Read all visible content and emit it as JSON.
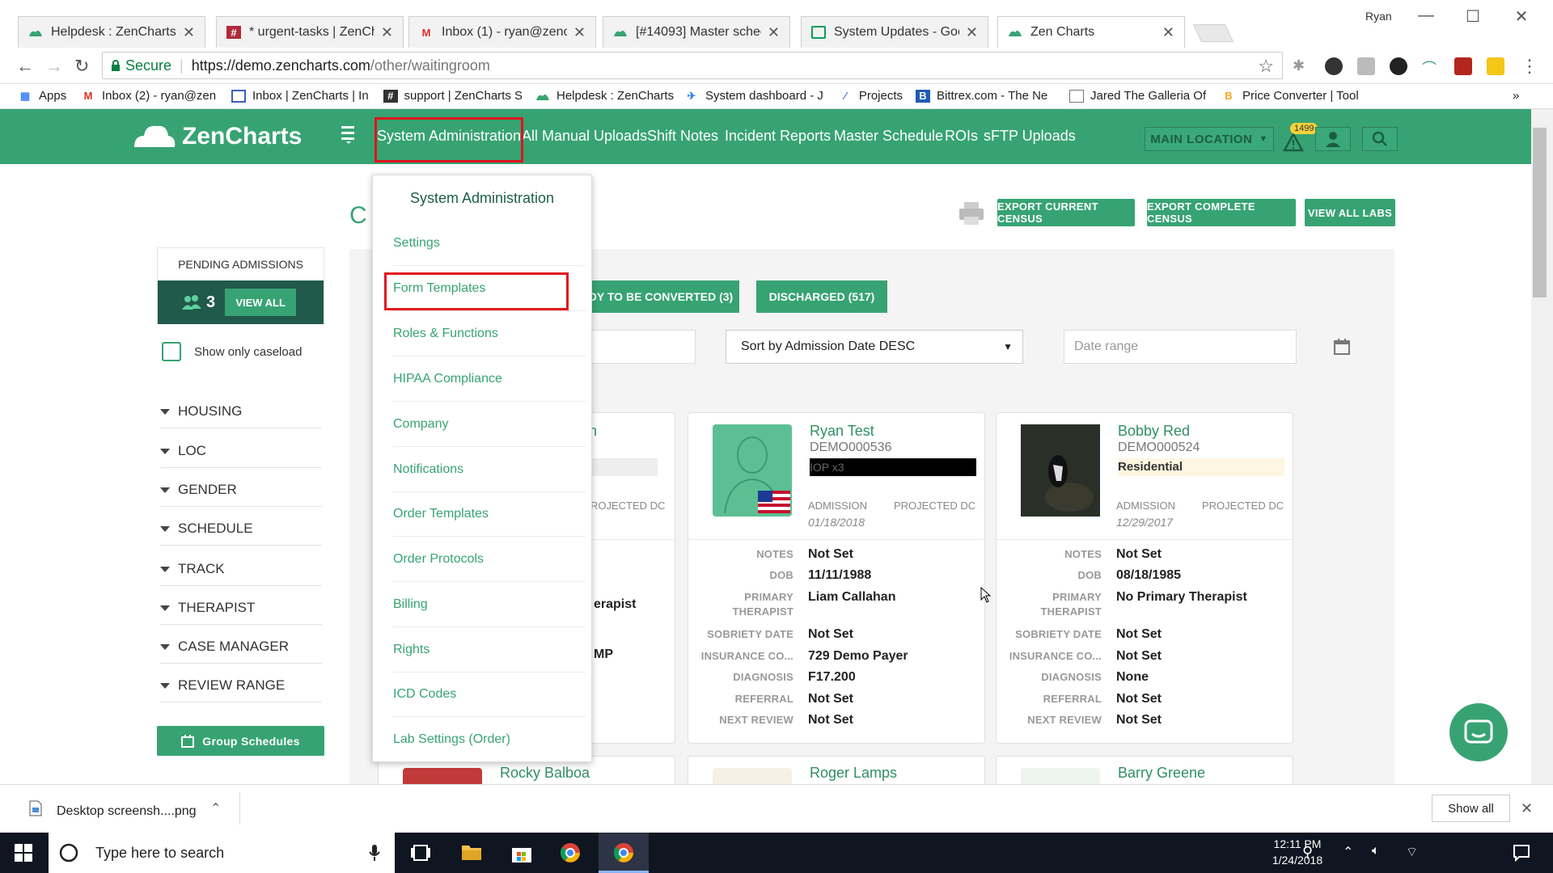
{
  "browser": {
    "tabs": [
      {
        "title": "Helpdesk : ZenCharts",
        "icon": "zencharts-icon"
      },
      {
        "title": "* urgent-tasks | ZenChart",
        "icon": "slack-icon"
      },
      {
        "title": "Inbox (1) - ryan@zenchar",
        "icon": "gmail-icon"
      },
      {
        "title": "[#14093] Master schedul",
        "icon": "zencharts-icon"
      },
      {
        "title": "System Updates - Googl",
        "icon": "sheets-icon"
      },
      {
        "title": "Zen Charts",
        "icon": "zencharts-icon"
      }
    ],
    "window_user": "Ryan",
    "secure_label": "Secure",
    "url_host": "https://demo.zencharts.com",
    "url_path": "/other/waitingroom",
    "bookmarks": [
      "Apps",
      "Inbox (2) - ryan@zen",
      "Inbox | ZenCharts | In",
      "support | ZenCharts S",
      "Helpdesk : ZenCharts",
      "System dashboard - J",
      "Projects",
      "Bittrex.com - The Ne",
      "Jared The Galleria Of",
      "Price Converter | Tool"
    ],
    "bookmarks_overflow": "»"
  },
  "app": {
    "logo": "ZenCharts",
    "nav": [
      "System Administration",
      "All Manual Uploads",
      "Shift Notes",
      "Incident Reports",
      "Master Schedule",
      "ROIs",
      "sFTP Uploads"
    ],
    "location_btn": "MAIN LOCATION",
    "alert_count": "1499",
    "page_title_partial": "C",
    "header_buttons": [
      "EXPORT CURRENT CENSUS",
      "EXPORT COMPLETE CENSUS",
      "VIEW ALL LABS"
    ],
    "pending": {
      "title": "PENDING ADMISSIONS",
      "count": "3",
      "view_all": "VIEW ALL"
    },
    "caseload_label": "Show only caseload",
    "filters": [
      "HOUSING",
      "LOC",
      "GENDER",
      "SCHEDULE",
      "TRACK",
      "THERAPIST",
      "CASE MANAGER",
      "REVIEW RANGE"
    ],
    "group_schedules": "Group Schedules",
    "status_tabs": [
      "DY TO BE CONVERTED (3)",
      "DISCHARGED (517)"
    ],
    "sort_label": "Sort by Admission Date DESC",
    "date_range_placeholder": "Date range",
    "field_labels": {
      "notes": "NOTES",
      "dob": "DOB",
      "therapist": "PRIMARY THERAPIST",
      "sobriety": "SOBRIETY DATE",
      "insurance": "INSURANCE CO...",
      "diagnosis": "DIAGNOSIS",
      "referral": "REFERRAL",
      "next_review": "NEXT REVIEW",
      "admission": "ADMISSION",
      "projected_dc": "PROJECTED DC"
    },
    "partial_card": {
      "name_fragment": "n",
      "projected_fragment": "ROJECTED DC",
      "therapist_fragment": "erapist",
      "insurance_fragment": "MP"
    },
    "cards": [
      {
        "name": "Ryan Test",
        "id": "DEMO000536",
        "tag": "IOP x3",
        "admission": "01/18/2018",
        "notes": "Not Set",
        "dob": "11/11/1988",
        "therapist": "Liam Callahan",
        "sobriety": "Not Set",
        "insurance": "729 Demo Payer",
        "diagnosis": "F17.200",
        "referral": "Not Set",
        "next_review": "Not Set"
      },
      {
        "name": "Bobby Red",
        "id": "DEMO000524",
        "tag": "Residential",
        "admission": "12/29/2017",
        "notes": "Not Set",
        "dob": "08/18/1985",
        "therapist": "No Primary Therapist",
        "sobriety": "Not Set",
        "insurance": "Not Set",
        "diagnosis": "None",
        "referral": "Not Set",
        "next_review": "Not Set"
      }
    ],
    "next_row_names": [
      "Rocky Balboa",
      "Roger Lamps",
      "Barry Greene"
    ],
    "dropdown": {
      "header": "System Administration",
      "items": [
        "Settings",
        "Form Templates",
        "Roles & Functions",
        "HIPAA Compliance",
        "Company",
        "Notifications",
        "Order Templates",
        "Order Protocols",
        "Billing",
        "Rights",
        "ICD Codes",
        "Lab Settings (Order)"
      ]
    }
  },
  "download": {
    "file": "Desktop screensh....png",
    "show_all": "Show all"
  },
  "taskbar": {
    "search_placeholder": "Type here to search",
    "time": "12:11 PM",
    "date": "1/24/2018"
  },
  "colors": {
    "brand_green": "#37a373",
    "dark_teal": "#21594a",
    "highlight_red": "#e0141e"
  }
}
